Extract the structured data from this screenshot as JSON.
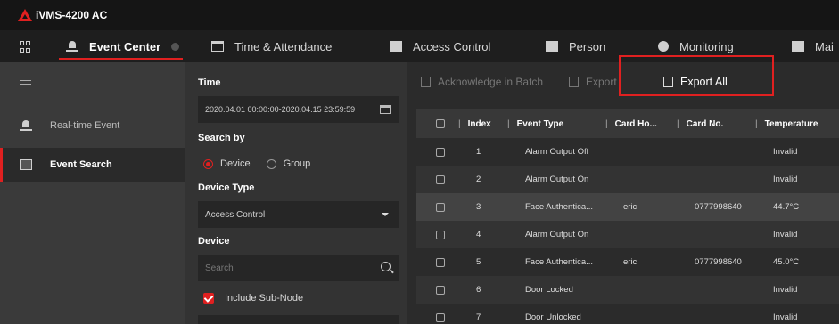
{
  "app": {
    "title": "iVMS-4200 AC",
    "accent": "#e02020"
  },
  "tabs": [
    {
      "label": "Event Center",
      "icon": "event-center-icon",
      "active": true
    },
    {
      "label": "Time & Attendance",
      "icon": "calendar-icon"
    },
    {
      "label": "Access Control",
      "icon": "access-control-icon"
    },
    {
      "label": "Person",
      "icon": "person-icon"
    },
    {
      "label": "Monitoring",
      "icon": "monitoring-icon"
    },
    {
      "label": "Mai",
      "icon": "maintenance-icon"
    }
  ],
  "sidebar": {
    "items": [
      {
        "label": "Real-time Event",
        "icon": "realtime-event-icon"
      },
      {
        "label": "Event Search",
        "icon": "event-search-icon",
        "active": true
      }
    ]
  },
  "filter": {
    "time_label": "Time",
    "time_value": "2020.04.01 00:00:00-2020.04.15 23:59:59",
    "search_by_label": "Search by",
    "search_by_options": [
      "Device",
      "Group"
    ],
    "search_by_selected": "Device",
    "device_type_label": "Device Type",
    "device_type_value": "Access Control",
    "device_label": "Device",
    "device_search_placeholder": "Search",
    "include_subnode_label": "Include Sub-Node"
  },
  "toolbar": {
    "acknowledge_label": "Acknowledge in Batch",
    "export_label": "Export",
    "export_all_label": "Export All"
  },
  "table": {
    "columns": [
      "Index",
      "Event Type",
      "Card Ho...",
      "Card No.",
      "Temperature"
    ],
    "rows": [
      {
        "index": "1",
        "event_type": "Alarm Output Off",
        "card_holder": "",
        "card_no": "",
        "temperature": "Invalid"
      },
      {
        "index": "2",
        "event_type": "Alarm Output On",
        "card_holder": "",
        "card_no": "",
        "temperature": "Invalid"
      },
      {
        "index": "3",
        "event_type": "Face Authentica...",
        "card_holder": "eric",
        "card_no": "0777998640",
        "temperature": "44.7°C"
      },
      {
        "index": "4",
        "event_type": "Alarm Output On",
        "card_holder": "",
        "card_no": "",
        "temperature": "Invalid"
      },
      {
        "index": "5",
        "event_type": "Face Authentica...",
        "card_holder": "eric",
        "card_no": "0777998640",
        "temperature": "45.0°C"
      },
      {
        "index": "6",
        "event_type": "Door Locked",
        "card_holder": "",
        "card_no": "",
        "temperature": "Invalid"
      },
      {
        "index": "7",
        "event_type": "Door Unlocked",
        "card_holder": "",
        "card_no": "",
        "temperature": "Invalid"
      }
    ]
  }
}
